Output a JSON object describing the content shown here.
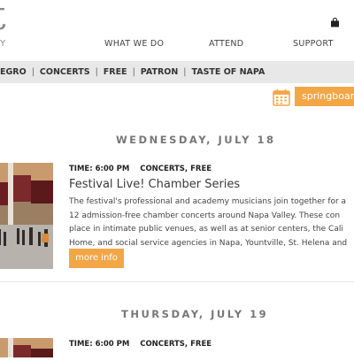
{
  "header": {
    "logo_fragment": "t",
    "logo_subtext": "Y",
    "nav": [
      "WHAT WE DO",
      "ATTEND",
      "SUPPORT"
    ]
  },
  "filters": [
    "EGRO",
    "CONCERTS",
    "FREE",
    "PATRON",
    "TASTE OF NAPA"
  ],
  "springboard": {
    "label": "springboard"
  },
  "events": [
    {
      "date": "WEDNESDAY, JULY 18",
      "time_label": "TIME: 6:00 PM",
      "categories": "CONCERTS,  FREE",
      "title": "Festival Live! Chamber Series",
      "description_lines": [
        "The festival's professional and academy musicians join together for a",
        "12 admission-free chamber concerts around Napa Valley. These con",
        "place in intimate public venues, as well as at senior centers, the Cali",
        "Home, and social service agencies in Napa, Yountville, St. Helena and"
      ],
      "button": "more info"
    },
    {
      "date": "THURSDAY, JULY 19",
      "time_label": "TIME: 6:00 PM",
      "categories": "CONCERTS,  FREE"
    }
  ],
  "colors": {
    "accent": "#f3a646",
    "filter_bar": "#e8e8e8"
  }
}
